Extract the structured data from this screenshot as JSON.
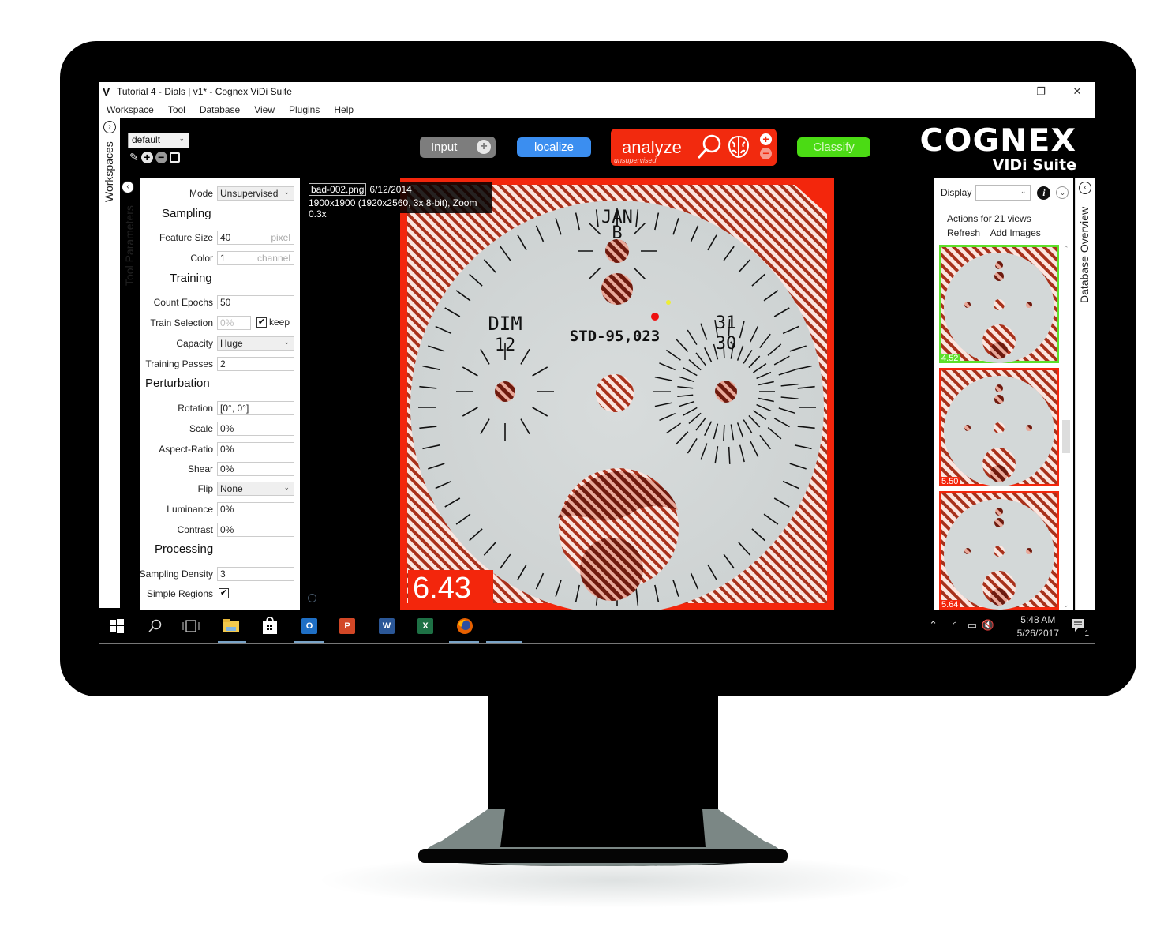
{
  "window": {
    "title": "Tutorial 4 - Dials | v1* - Cognex ViDi Suite",
    "logo_glyph": "V",
    "minimize": "–",
    "restore": "❐",
    "close": "✕"
  },
  "menu": [
    "Workspace",
    "Tool",
    "Database",
    "View",
    "Plugins",
    "Help"
  ],
  "left_tabs": {
    "workspaces": "Workspaces",
    "tool_parameters": "Tool Parameters"
  },
  "workspace": {
    "selected": "default"
  },
  "pipeline": {
    "input": "Input",
    "localize": "localize",
    "analyze": "analyze",
    "analyze_sub": "unsupervised",
    "classify": "Classify",
    "colors": {
      "input": "#7d7d7d",
      "localize": "#3b8ef0",
      "analyze": "#f22a0e",
      "classify": "#4bdb14"
    }
  },
  "logo": {
    "brand": "COGNEX",
    "product": "VIDi Suite"
  },
  "parameters": {
    "mode": {
      "label": "Mode",
      "value": "Unsupervised"
    },
    "sections": {
      "sampling": "Sampling",
      "training": "Training",
      "perturbation": "Perturbation",
      "processing": "Processing"
    },
    "feature_size": {
      "label": "Feature Size",
      "value": "40",
      "unit": "pixel"
    },
    "color": {
      "label": "Color",
      "value": "1",
      "unit": "channel"
    },
    "count_epochs": {
      "label": "Count Epochs",
      "value": "50"
    },
    "train_selection": {
      "label": "Train Selection",
      "value": "0%",
      "keep_label": "keep",
      "keep_checked": true
    },
    "capacity": {
      "label": "Capacity",
      "value": "Huge"
    },
    "training_passes": {
      "label": "Training Passes",
      "value": "2"
    },
    "rotation": {
      "label": "Rotation",
      "value": "[0°, 0°]"
    },
    "scale": {
      "label": "Scale",
      "value": "0%"
    },
    "aspect_ratio": {
      "label": "Aspect-Ratio",
      "value": "0%"
    },
    "shear": {
      "label": "Shear",
      "value": "0%"
    },
    "flip": {
      "label": "Flip",
      "value": "None"
    },
    "luminance": {
      "label": "Luminance",
      "value": "0%"
    },
    "contrast": {
      "label": "Contrast",
      "value": "0%"
    },
    "sampling_density": {
      "label": "Sampling Density",
      "value": "3"
    },
    "simple_regions": {
      "label": "Simple Regions",
      "checked": true
    }
  },
  "viewer": {
    "filename": "bad-002.png",
    "date": "6/12/2014",
    "details": "1900x1900 (1920x2560, 3x 8-bit), Zoom 0.3x",
    "score": "6.43",
    "dial_text": {
      "top": "JAN",
      "top2": "B",
      "left": "DIM",
      "left2": "12",
      "center": "STD-95,023",
      "right": "31",
      "right2": "30"
    }
  },
  "database": {
    "tab_label": "Database Overview",
    "display_label": "Display",
    "display_value": "",
    "actions_label": "Actions for 21 views",
    "refresh": "Refresh",
    "add_images": "Add Images",
    "thumbnails": [
      {
        "score": "4.52",
        "status": "good",
        "color": "#5ee02a"
      },
      {
        "score": "5.50",
        "status": "bad",
        "color": "#f3260c"
      },
      {
        "score": "5.64",
        "status": "bad",
        "color": "#f3260c"
      }
    ]
  },
  "taskbar": {
    "time": "5:48 AM",
    "date": "5/26/2017",
    "notifications": "1",
    "apps": [
      {
        "name": "start",
        "glyph": "⊞"
      },
      {
        "name": "search",
        "glyph": "⚲"
      },
      {
        "name": "task-view",
        "glyph": "❐"
      },
      {
        "name": "file-explorer",
        "glyph": "▬",
        "color": "#f2c94c"
      },
      {
        "name": "store",
        "glyph": "🛍"
      },
      {
        "name": "outlook",
        "glyph": "O",
        "color": "#1f6fc5"
      },
      {
        "name": "powerpoint",
        "glyph": "P",
        "color": "#d24726"
      },
      {
        "name": "word",
        "glyph": "W",
        "color": "#2b5797"
      },
      {
        "name": "excel",
        "glyph": "X",
        "color": "#1e7145"
      },
      {
        "name": "firefox",
        "glyph": "◉",
        "color": "#e66000"
      }
    ]
  }
}
